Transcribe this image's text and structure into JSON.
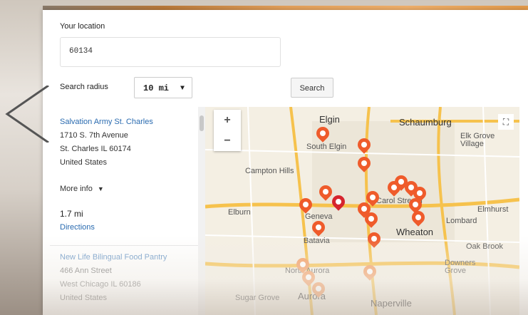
{
  "form": {
    "location_label": "Your location",
    "location_value": "60134",
    "radius_label": "Search radius",
    "radius_value": "10 mi",
    "search_button": "Search"
  },
  "results": [
    {
      "name": "Salvation Army St. Charles",
      "street": "1710 S. 7th Avenue",
      "city": "St. Charles IL 60174",
      "country": "United States",
      "more_info": "More info",
      "distance": "1.7 mi",
      "directions": "Directions"
    },
    {
      "name": "New Life Bilingual Food Pantry",
      "street": "466 Ann Street",
      "city": "West Chicago IL 60186",
      "country": "United States"
    }
  ],
  "map": {
    "zoom_in": "+",
    "zoom_out": "−",
    "fullscreen_icon": "fullscreen-icon",
    "labels": [
      "Elgin",
      "Schaumburg",
      "Elk Grove Village",
      "South Elgin",
      "Campton Hills",
      "Elburn",
      "Geneva",
      "Carol Stream",
      "Wheaton",
      "Lombard",
      "Elmhurst",
      "Batavia",
      "North Aurora",
      "Aurora",
      "Naperville",
      "Oak Brook",
      "Downers Grove",
      "Sugar Grove"
    ],
    "pin_color_active": "#d6252e",
    "pin_color": "#ef5b2b",
    "pin_color_light": "#f49a5e"
  }
}
